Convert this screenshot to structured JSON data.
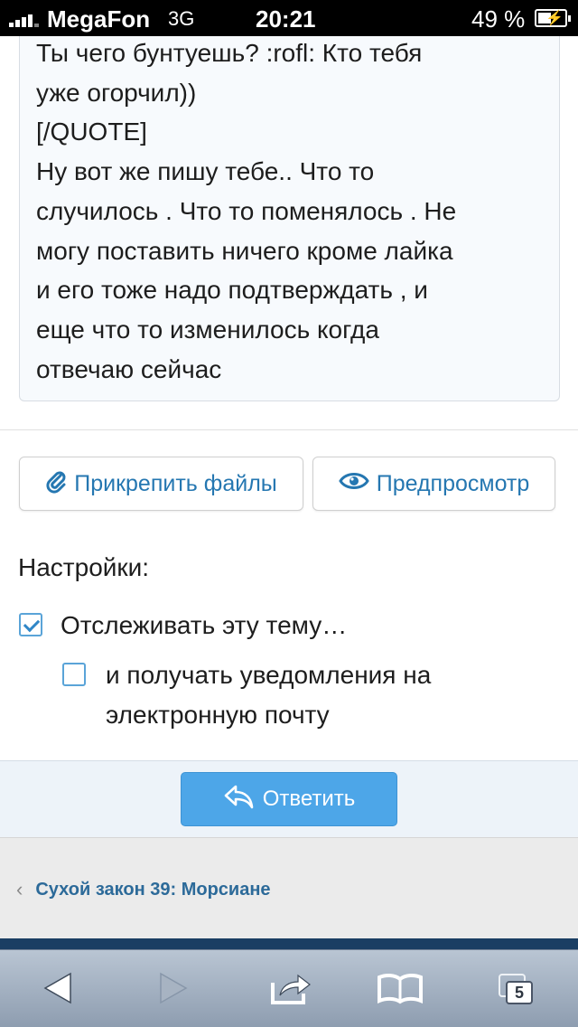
{
  "status_bar": {
    "carrier": "MegaFon",
    "network": "3G",
    "time": "20:21",
    "battery": "49 %",
    "battery_level": 0.49
  },
  "editor": {
    "lines": [
      "Ты чего бунтуешь? :rofl: Кто тебя",
      "уже огорчил))",
      "[/QUOTE]",
      "Ну вот же пишу тебе.. Что то",
      "случилось . Что то поменялось . Не",
      "могу поставить ничего кроме лайка",
      "и его тоже надо подтверждать , и",
      "еще что то изменилось когда",
      "отвечаю сейчас"
    ]
  },
  "buttons": {
    "attach_label": "Прикрепить файлы",
    "preview_label": "Предпросмотр",
    "reply_label": "Ответить"
  },
  "settings": {
    "title": "Настройки:",
    "watch_label": "Отслеживать эту тему…",
    "watch_checked": true,
    "email_label_line1": "и получать уведомления на",
    "email_label_line2": "электронную почту",
    "email_checked": false
  },
  "breadcrumb": {
    "label": "Сухой закон 39: Морсиане"
  },
  "toolbar": {
    "tab_count": "5",
    "icons": [
      "back-arrow-icon",
      "forward-arrow-icon",
      "share-icon",
      "bookmarks-icon",
      "tabs-icon"
    ]
  },
  "colors": {
    "accent": "#2577b1",
    "reply_button": "#4da6e8",
    "breadcrumb_link": "#2c6a99"
  }
}
